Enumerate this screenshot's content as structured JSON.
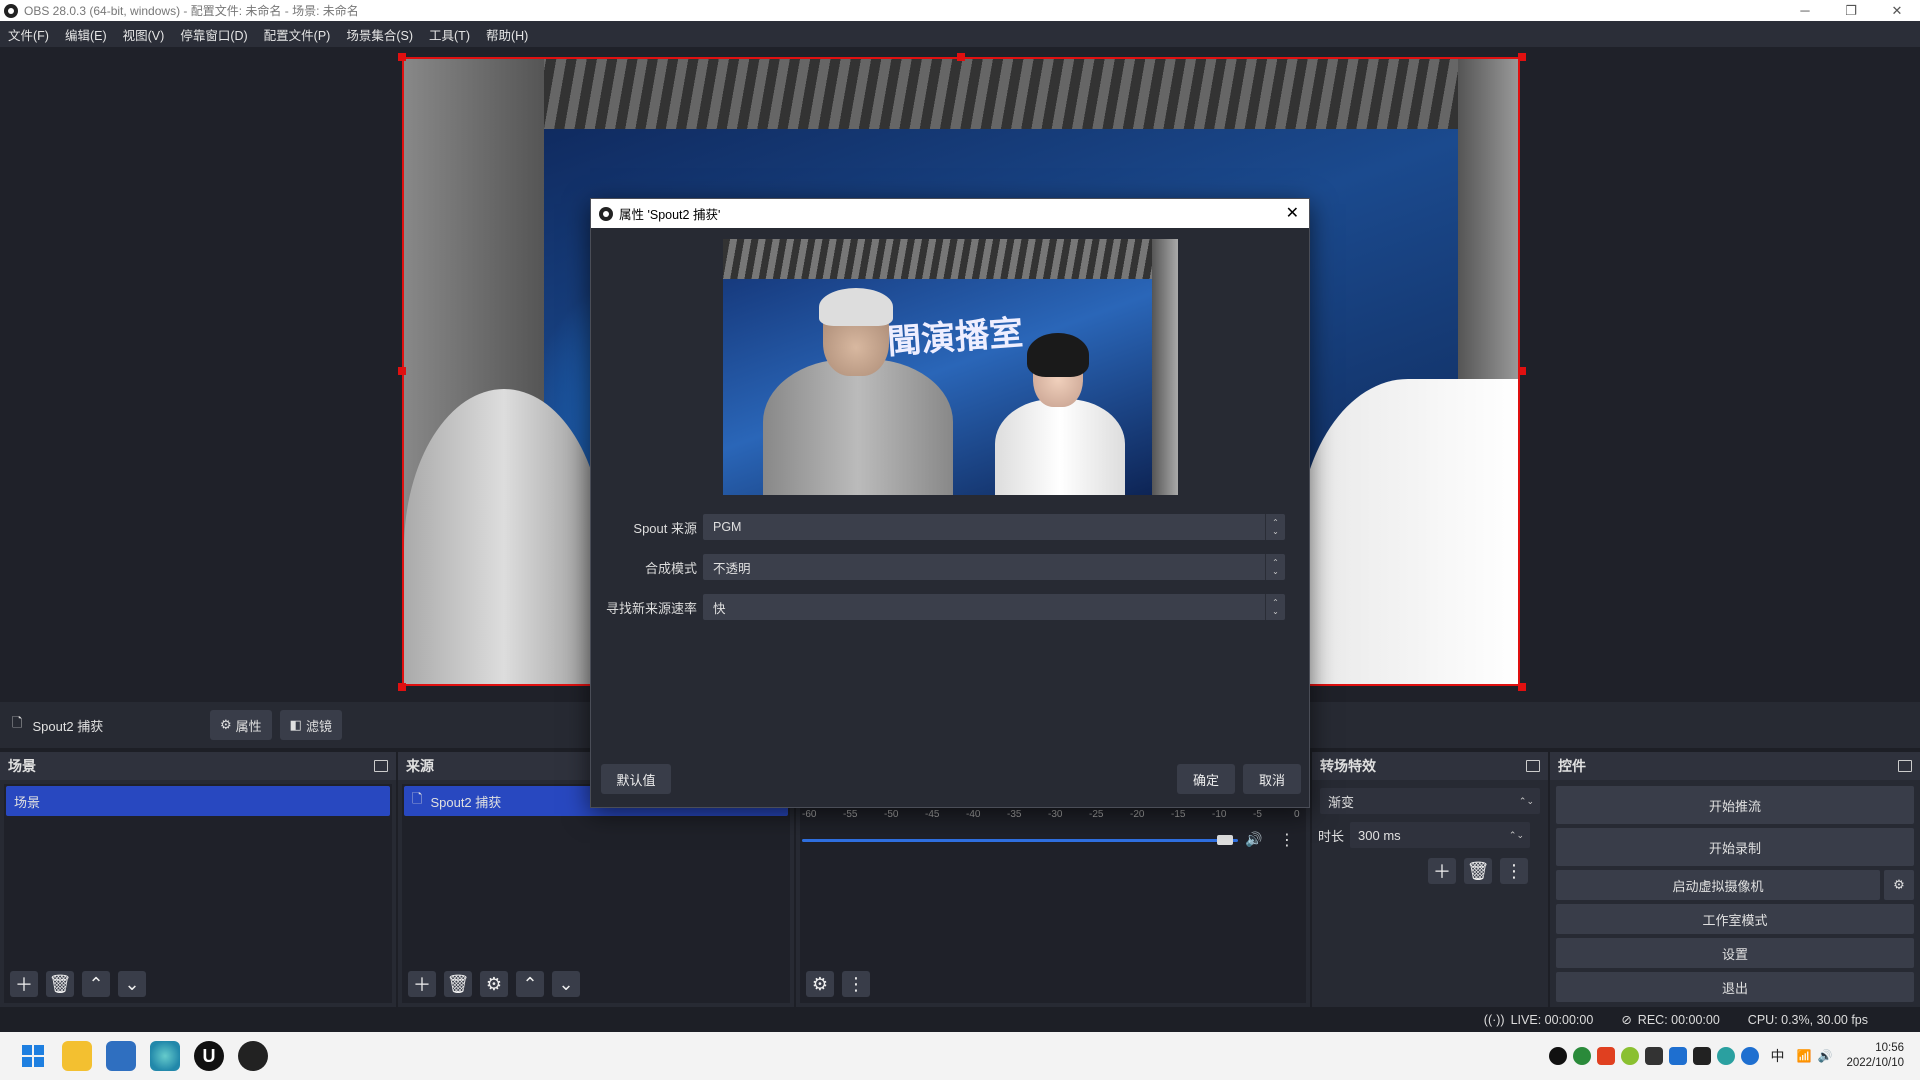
{
  "window": {
    "title": "OBS 28.0.3 (64-bit, windows) - 配置文件: 未命名 - 场景: 未命名",
    "minimize": "─",
    "restore": "❐",
    "close": "✕"
  },
  "menu": [
    "文件(F)",
    "编辑(E)",
    "视图(V)",
    "停靠窗口(D)",
    "配置文件(P)",
    "场景集合(S)",
    "工具(T)",
    "帮助(H)"
  ],
  "source_toolbar": {
    "source_name": "Spout2 捕获",
    "properties": "属性",
    "filters": "滤镜"
  },
  "scenes": {
    "title": "场景",
    "items": [
      "场景"
    ]
  },
  "sources": {
    "title": "来源",
    "items": [
      "Spout2 捕获"
    ]
  },
  "transitions": {
    "title": "转场特效",
    "selected": "渐变",
    "duration_label": "时长",
    "duration_value": "300 ms"
  },
  "controls": {
    "title": "控件",
    "start_stream": "开始推流",
    "start_record": "开始录制",
    "virtual_cam": "启动虚拟摄像机",
    "studio_mode": "工作室模式",
    "settings": "设置",
    "exit": "退出"
  },
  "mixer": {
    "ticks": [
      "-60",
      "-55",
      "-50",
      "-45",
      "-40",
      "-35",
      "-30",
      "-25",
      "-20",
      "-15",
      "-10",
      "-5",
      "0"
    ],
    "level": 0.97
  },
  "status": {
    "live": "LIVE: 00:00:00",
    "rec": "REC: 00:00:00",
    "cpu": "CPU: 0.3%, 30.00 fps"
  },
  "dialog": {
    "title": "属性 'Spout2 捕获'",
    "preview_text": "新聞演播室",
    "fields": [
      {
        "label": "Spout 来源",
        "value": "PGM"
      },
      {
        "label": "合成模式",
        "value": "不透明"
      },
      {
        "label": "寻找新来源速率",
        "value": "快"
      }
    ],
    "defaults": "默认值",
    "ok": "确定",
    "cancel": "取消"
  },
  "taskbar": {
    "time": "10:56",
    "date": "2022/10/10",
    "ime": "中"
  }
}
